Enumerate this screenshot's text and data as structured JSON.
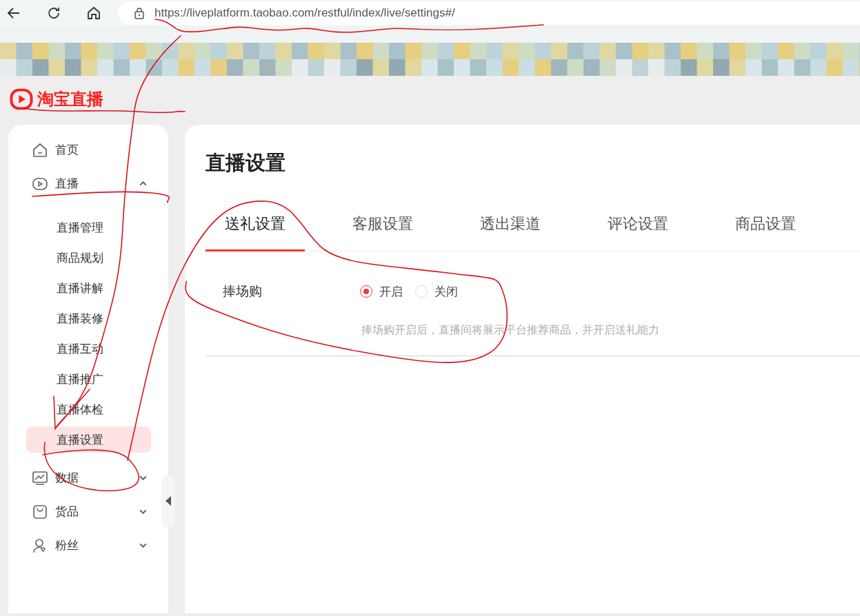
{
  "browser": {
    "url": "https://liveplatform.taobao.com/restful/index/live/settings#/"
  },
  "logo": {
    "text": "淘宝直播"
  },
  "sidebar": {
    "items": [
      {
        "label": "首页"
      },
      {
        "label": "直播",
        "expanded": true,
        "children": [
          {
            "label": "直播管理",
            "selected": false
          },
          {
            "label": "商品规划",
            "selected": false
          },
          {
            "label": "直播讲解",
            "selected": false
          },
          {
            "label": "直播装修",
            "selected": false
          },
          {
            "label": "直播互动",
            "selected": false
          },
          {
            "label": "直播推广",
            "selected": false
          },
          {
            "label": "直播体检",
            "selected": false
          },
          {
            "label": "直播设置",
            "selected": true
          }
        ]
      },
      {
        "label": "数据",
        "expanded": false
      },
      {
        "label": "货品",
        "expanded": false
      },
      {
        "label": "粉丝",
        "expanded": false
      }
    ]
  },
  "page": {
    "title": "直播设置",
    "tabs": [
      {
        "label": "送礼设置",
        "selected": true
      },
      {
        "label": "客服设置",
        "selected": false
      },
      {
        "label": "透出渠道",
        "selected": false
      },
      {
        "label": "评论设置",
        "selected": false
      },
      {
        "label": "商品设置",
        "selected": false
      }
    ],
    "settings": [
      {
        "label": "捧场购",
        "options": [
          {
            "label": "开启",
            "selected": true
          },
          {
            "label": "关闭",
            "selected": false
          }
        ],
        "hint": "捧场购开启后，直播间将展示平台推荐商品，并开启送礼能力"
      }
    ]
  }
}
